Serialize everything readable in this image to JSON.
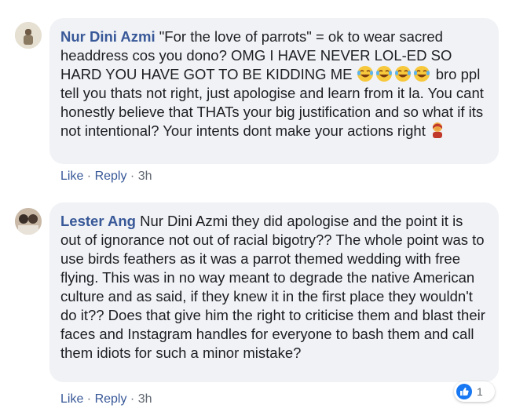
{
  "comments": [
    {
      "author": "Nur Dini Azmi",
      "text_parts": [
        " \"For the love of parrots\" = ok to wear sacred headdress cos you dono? OMG I HAVE NEVER LOL-ED SO HARD YOU HAVE GOT TO BE KIDDING ME ",
        " bro ppl tell you thats not right, just apologise and learn from it la. You cant honestly believe that THATs your big justification and so what if its not intentional? Your intents dont make your actions right "
      ],
      "emoji_icons": [
        "tears-of-joy-emoji-icon",
        "tears-of-joy-emoji-icon",
        "tears-of-joy-emoji-icon",
        "tears-of-joy-emoji-icon"
      ],
      "end_emoji_icon": "facepalm-emoji-icon",
      "actions": {
        "like": "Like",
        "sep1": " · ",
        "reply": "Reply",
        "sep2": " · ",
        "time": "3h"
      }
    },
    {
      "author": "Lester Ang",
      "text": " Nur Dini Azmi they did apologise and the point it is out of ignorance not out of racial bigotry?? The whole point was to use birds feathers as it was a parrot themed wedding with free flying. This was in no way meant to degrade the native American culture and as said, if they knew it in the first place they wouldn't do it?? Does that give him the right to criticise them and blast their faces and Instagram handles for everyone to bash them and call them idiots for such a minor mistake?",
      "actions": {
        "like": "Like",
        "sep1": " · ",
        "reply": "Reply",
        "sep2": " · ",
        "time": "3h"
      },
      "reaction": {
        "icon": "like-thumb-icon",
        "count": "1",
        "color": "#1877f2"
      }
    }
  ]
}
